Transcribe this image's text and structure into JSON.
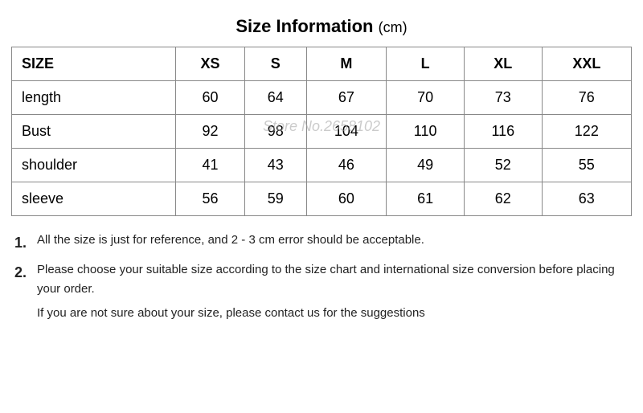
{
  "title": "Size Information",
  "unit": "(cm)",
  "table": {
    "headers": [
      "SIZE",
      "XS",
      "S",
      "M",
      "L",
      "XL",
      "XXL"
    ],
    "rows": [
      {
        "label": "length",
        "values": [
          "60",
          "64",
          "67",
          "70",
          "73",
          "76"
        ]
      },
      {
        "label": "Bust",
        "values": [
          "92",
          "98",
          "104",
          "110",
          "116",
          "122"
        ]
      },
      {
        "label": "shoulder",
        "values": [
          "41",
          "43",
          "46",
          "49",
          "52",
          "55"
        ]
      },
      {
        "label": "sleeve",
        "values": [
          "56",
          "59",
          "60",
          "61",
          "62",
          "63"
        ]
      }
    ]
  },
  "notes": [
    {
      "num": "1.",
      "text": "All the size is just for reference, and 2 - 3 cm error should be acceptable."
    },
    {
      "num": "2.",
      "text": "Please choose your suitable size according to the size chart and international size conversion before placing your order."
    },
    {
      "num": "",
      "text": "If you are not sure about your size, please contact us for the suggestions"
    }
  ],
  "watermark": "Store No.2658102"
}
